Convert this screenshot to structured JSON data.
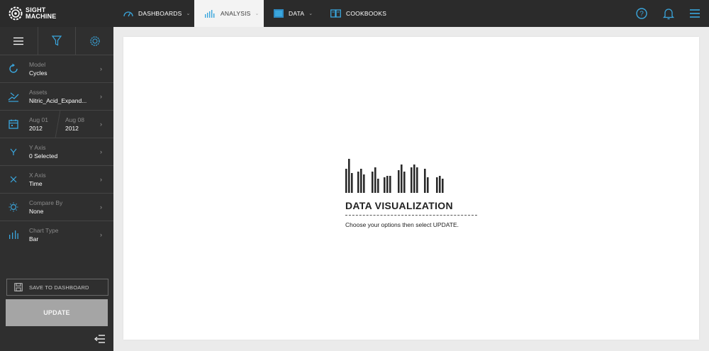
{
  "brand": {
    "line1": "SIGHT",
    "line2": "MACHINE"
  },
  "nav": [
    {
      "label": "DASHBOARDS",
      "icon": "gauge-icon",
      "dropdown": true,
      "active": false
    },
    {
      "label": "ANALYSIS",
      "icon": "bar-chart-icon",
      "dropdown": true,
      "active": true
    },
    {
      "label": "DATA",
      "icon": "data-icon",
      "dropdown": true,
      "active": false
    },
    {
      "label": "COOKBOOKS",
      "icon": "book-icon",
      "dropdown": false,
      "active": false
    }
  ],
  "sidebar": {
    "options": [
      {
        "label": "Model",
        "value": "Cycles",
        "icon": "cycle-icon"
      },
      {
        "label": "Assets",
        "value": "Nitric_Acid_Expand...",
        "icon": "asset-icon"
      },
      {
        "label": "Y Axis",
        "value": "0 Selected",
        "icon": "y-axis-icon"
      },
      {
        "label": "X Axis",
        "value": "Time",
        "icon": "x-axis-icon"
      },
      {
        "label": "Compare By",
        "value": "None",
        "icon": "compare-icon"
      },
      {
        "label": "Chart Type",
        "value": "Bar",
        "icon": "chart-type-icon"
      }
    ],
    "date_start": {
      "day": "Aug 01",
      "year": "2012"
    },
    "date_end": {
      "day": "Aug 08",
      "year": "2012"
    },
    "save_label": "SAVE TO DASHBOARD",
    "update_label": "UPDATE"
  },
  "main": {
    "title": "DATA VISUALIZATION",
    "subtitle": "Choose your options then select UPDATE."
  },
  "colors": {
    "accent": "#3aa6dd",
    "nav_bg": "#2b2b2b",
    "sidebar_bg": "#2f2f2f",
    "update_bg": "#a5a5a5"
  }
}
